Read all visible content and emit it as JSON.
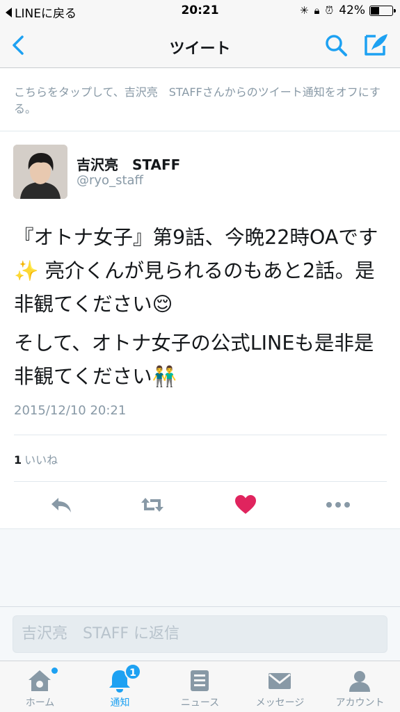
{
  "status_bar": {
    "back_app": "LINEに戻る",
    "time": "20:21",
    "battery": "42%",
    "battery_level": 0.42
  },
  "nav": {
    "title": "ツイート"
  },
  "notice": {
    "text": "こちらをタップして、吉沢亮　STAFFさんからのツイート通知をオフにする。"
  },
  "tweet": {
    "name": "吉沢亮　STAFF",
    "handle": "@ryo_staff",
    "text_1": "『オトナ女子』第9話、今晩22時OAです✨ 亮介くんが見られるのもあと2話。是非観てください😌",
    "text_2": "そして、オトナ女子の公式LINEも是非是非観てください👬",
    "timestamp": "2015/12/10 20:21",
    "like_count": "1",
    "like_label": "いいね"
  },
  "actions": {
    "liked": true,
    "heart_color": "#e0245e",
    "icon_color": "#8899a6"
  },
  "reply": {
    "placeholder": "吉沢亮　STAFF に返信"
  },
  "tabbar": {
    "tabs": [
      {
        "label": "ホーム",
        "icon": "home-icon"
      },
      {
        "label": "通知",
        "icon": "bell-icon",
        "active": true
      },
      {
        "label": "ニュース",
        "icon": "news-icon"
      },
      {
        "label": "メッセージ",
        "icon": "envelope-icon"
      },
      {
        "label": "アカウント",
        "icon": "person-icon"
      }
    ],
    "notification_badge": "1"
  },
  "colors": {
    "accent": "#1da1f2",
    "muted": "#8899a6"
  }
}
